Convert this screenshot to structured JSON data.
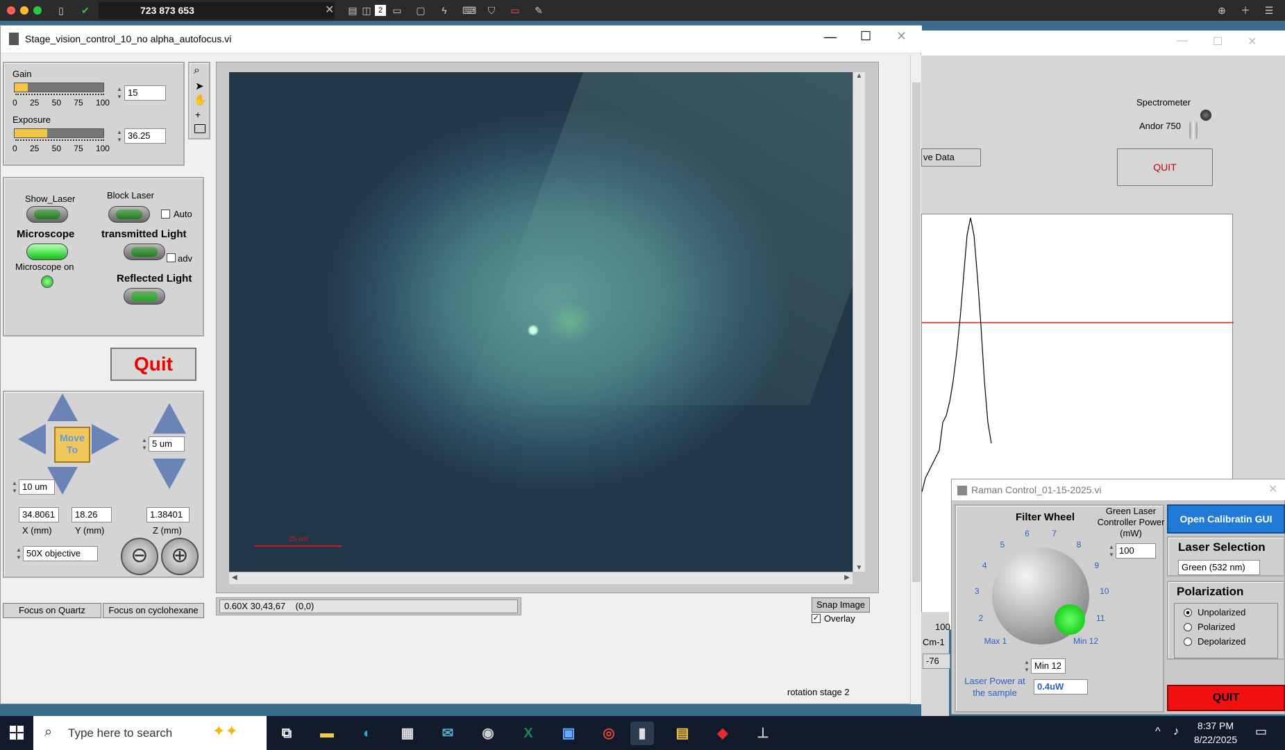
{
  "remote": {
    "session_id": "723 873 653"
  },
  "main_window": {
    "title": "Stage_vision_control_10_no alpha_autofocus.vi",
    "gain": {
      "label": "Gain",
      "value": "15",
      "level": 0.15,
      "ticks": [
        "0",
        "25",
        "50",
        "75",
        "100"
      ]
    },
    "exposure": {
      "label": "Exposure",
      "value": "36.25",
      "level": 0.3625,
      "ticks": [
        "0",
        "25",
        "50",
        "75",
        "100"
      ]
    },
    "show_laser": "Show_Laser",
    "block_laser": "Block Laser",
    "auto": "Auto",
    "microscope": "Microscope",
    "microscope_on": "Microscope on",
    "transmitted_light": "transmitted Light",
    "adv": "adv",
    "reflected_light": "Reflected Light",
    "quit": "Quit",
    "move_to": "Move To",
    "xy_step": "10 um",
    "z_step": "5 um",
    "x_value": "34.8061",
    "y_value": "18.26",
    "z_value": "1.38401",
    "x_label": "X (mm)",
    "y_label": "Y (mm)",
    "z_label": "Z (mm)",
    "objective": "50X objective",
    "focus_quartz": "Focus on Quartz",
    "focus_cyclohexane": "Focus on cyclohexane",
    "scale_bar": "25 um",
    "status_readout": "0.60X 30,43,67    (0,0)",
    "snap_image": "Snap Image",
    "overlay": "Overlay",
    "rotation_stage": "rotation stage 2"
  },
  "background_window": {
    "spectrometer_label": "Spectrometer",
    "spectrometer_value": "Andor 750",
    "quit": "QUIT",
    "save_data": "ve Data",
    "axis_tick": "100",
    "axis_unit": "Cm-1",
    "field_value": "-76"
  },
  "raman_window": {
    "title": "Raman Control_01-15-2025.vi",
    "filter_wheel": "Filter Wheel",
    "dial_labels": [
      "Max 1",
      "2",
      "3",
      "4",
      "5",
      "6",
      "7",
      "8",
      "9",
      "10",
      "11",
      "Min 12"
    ],
    "dial_value": "Min 12",
    "green_laser_power_label": "Green Laser Controller Power (mW)",
    "green_laser_power": "100",
    "laser_power_sample_label": "Laser Power at the sample",
    "laser_power_sample": "0.4uW",
    "open_calibration": "Open Calibratin GUI",
    "laser_selection_label": "Laser Selection",
    "laser_selection": "Green (532 nm)",
    "polarization_label": "Polarization",
    "polarization_options": [
      "Unpolarized",
      "Polarized",
      "Depolarized"
    ],
    "polarization_selected": "Unpolarized",
    "quit": "QUIT"
  },
  "taskbar": {
    "search_placeholder": "Type here to search",
    "time": "8:37 PM",
    "date": "8/22/2025"
  }
}
